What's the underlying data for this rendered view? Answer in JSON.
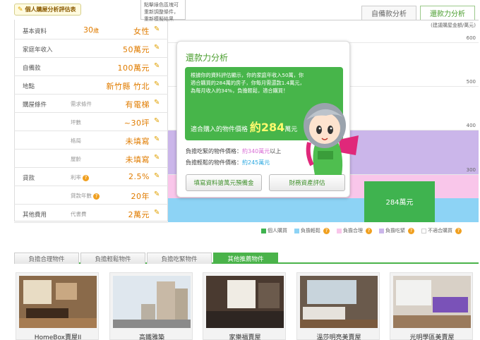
{
  "form": {
    "title": "個人購屋分析評估表",
    "rows": [
      {
        "label": "基本資料",
        "value1": "30",
        "unit1": "歲",
        "value2": "女性"
      },
      {
        "label": "家庭年收入",
        "value": "50萬元"
      },
      {
        "label": "自備款",
        "value": "100萬元"
      },
      {
        "label": "地點",
        "value": "新竹縣 竹北"
      },
      {
        "label": "購屋條件",
        "sub": "需求條件",
        "value": "有電梯"
      },
      {
        "sub": "坪數",
        "value": "~30坪"
      },
      {
        "sub": "格局",
        "value": "未填寫"
      },
      {
        "sub": "屋齡",
        "value": "未填寫"
      },
      {
        "label": "貸款",
        "sub": "利率",
        "value": "2.5%"
      },
      {
        "sub": "貸款年數",
        "value": "20年"
      },
      {
        "label": "其他費用",
        "sub": "代書費",
        "value": "2萬元"
      }
    ]
  },
  "tooltip": "點擊綠色區塊可重新調整條件，重新模擬結果",
  "tabs": {
    "self_pay": "自備款分析",
    "loan": "還款力分析"
  },
  "chart": {
    "unit_label": "(建議購屋金額/萬元)",
    "ticks": [
      "600",
      "500",
      "400",
      "300"
    ],
    "bar_label": "284萬元"
  },
  "chart_data": {
    "type": "bar",
    "title": "",
    "ylabel": "(建議購屋金額/萬元)",
    "ylim": [
      190,
      650
    ],
    "bands": [
      {
        "name": "負擔輕鬆",
        "from": 190,
        "to": 245
      },
      {
        "name": "負擔合理",
        "from": 245,
        "to": 300
      },
      {
        "name": "負擔吃緊",
        "from": 300,
        "to": 400
      }
    ],
    "series": [
      {
        "name": "個人購買",
        "values": [
          284
        ]
      }
    ]
  },
  "legend": [
    {
      "label": "個人購買",
      "color": "#3fb34f"
    },
    {
      "label": "負擔輕鬆",
      "color": "#8dd3f5"
    },
    {
      "label": "負擔合理",
      "color": "#f9c6ea"
    },
    {
      "label": "負擔吃緊",
      "color": "#cbb6ea"
    },
    {
      "label": "不適合購買",
      "color": "#ffffff"
    }
  ],
  "popup": {
    "title": "還款力分析",
    "desc_lines": [
      "根據你的資料評估顯示，你的家庭年收入50萬，你",
      "適合購買的284萬的房子，你每月需還款1.4萬元，",
      "為每月收入的34%，負擔輕鬆，適合購買！"
    ],
    "afford_prefix": "適合購入的物件價格",
    "afford_value": "約284",
    "afford_suffix": "萬元",
    "tight_label": "負擔吃緊的物件價格：",
    "tight_value": "約340萬元",
    "tight_suffix": "以上",
    "easy_label": "負擔輕鬆的物件價格：",
    "easy_value": "約245萬元",
    "btn_bank": "填寫資料搶萬元預備金",
    "btn_assets": "財務資產評估"
  },
  "bottom_tabs": [
    "負擔合理物件",
    "負擔輕鬆物件",
    "負擔吃緊物件",
    "其他推薦物件"
  ],
  "listings": [
    {
      "name": "HomeBox賣屋II"
    },
    {
      "name": "高鐵雅築"
    },
    {
      "name": "家樂福賣屋"
    },
    {
      "name": "溫莎明亮美賣屋"
    },
    {
      "name": "光明學區美賣屋"
    }
  ]
}
